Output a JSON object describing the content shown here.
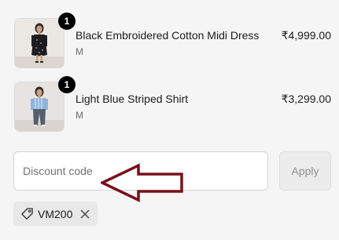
{
  "line_items": [
    {
      "quantity": "1",
      "name": "Black Embroidered Cotton Midi Dress",
      "variant": "M",
      "price": "₹4,999.00",
      "thumbnail_icon": "black-dress-product-photo"
    },
    {
      "quantity": "1",
      "name": "Light Blue Striped Shirt",
      "variant": "M",
      "price": "₹3,299.00",
      "thumbnail_icon": "blue-shirt-product-photo"
    }
  ],
  "discount": {
    "placeholder": "Discount code",
    "value": "",
    "apply_label": "Apply"
  },
  "applied_code": {
    "code": "VM200",
    "icon": "tag-icon",
    "remove_icon": "close-icon"
  },
  "annotation": {
    "icon": "left-arrow-annotation",
    "color": "#7a0f1c"
  },
  "colors": {
    "badge": "#000000",
    "apply_disabled_bg": "#ececec",
    "chip_bg": "#e8e8e8"
  }
}
